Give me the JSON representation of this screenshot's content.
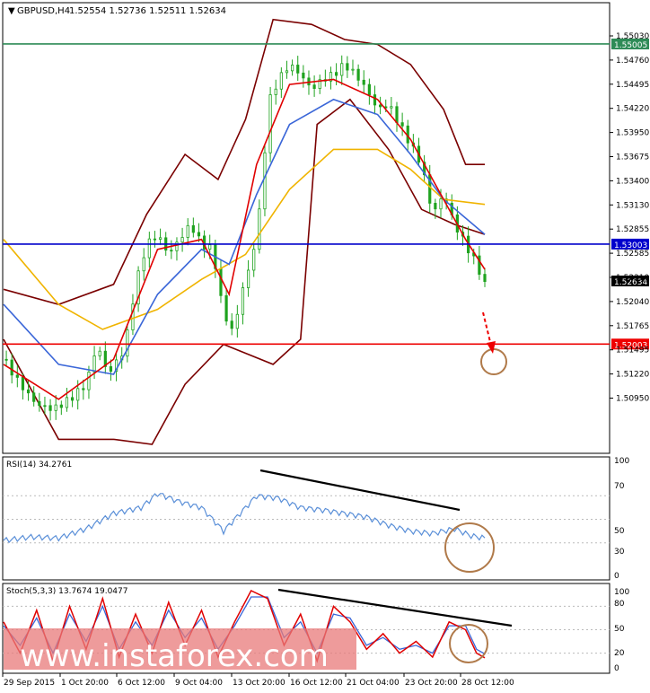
{
  "header": {
    "symbol": "GBPUSD,H4",
    "ohlc": "1.52554 1.52736 1.52511 1.52634"
  },
  "watermark": {
    "text": "www.instaforex.com"
  },
  "rsi_label": "RSI(14) 34.2761",
  "stoch_label": "Stoch(5,3,3) 13.7674 19.0477",
  "price_axis_ticks": [
    "1.55030",
    "1.54760",
    "1.54495",
    "1.54220",
    "1.53950",
    "1.53675",
    "1.53400",
    "1.53130",
    "1.52855",
    "1.52585",
    "1.52310",
    "1.52040",
    "1.51765",
    "1.51495",
    "1.51220",
    "1.50950"
  ],
  "rsi_axis_ticks": [
    "100",
    "70",
    "50",
    "30",
    "0"
  ],
  "stoch_axis_ticks": [
    "100",
    "80",
    "50",
    "20",
    "0"
  ],
  "time_labels": [
    "29 Sep 2015",
    "1 Oct 20:00",
    "6 Oct 12:00",
    "9 Oct 04:00",
    "13 Oct 20:00",
    "16 Oct 12:00",
    "21 Oct 04:00",
    "23 Oct 20:00",
    "28 Oct 12:00"
  ],
  "levels": [
    {
      "name": "resistance",
      "label": "1.55005",
      "value": 1.55005,
      "color": "#2e8b57"
    },
    {
      "name": "pivot",
      "label": "1.53003",
      "value": 1.53003,
      "color": "#0000cc"
    },
    {
      "name": "support",
      "label": "1.52003",
      "value": 1.52003,
      "color": "#ee0000"
    },
    {
      "name": "current",
      "label": "1.52634",
      "value": 1.52634,
      "color": "#000000"
    }
  ],
  "colors": {
    "up_candle": "#1fa31f",
    "down_candle": "#1fa31f",
    "fast_ma": "#e00000",
    "mid_ma": "#3a66d8",
    "slow_ma": "#f0b400",
    "envelope": "#7a0000",
    "rsi": "#5a8fd8",
    "stoch_main": "#e00000",
    "stoch_signal": "#3a66d8",
    "circle": "#b07a4a"
  },
  "chart_data": {
    "type": "candlestick",
    "instrument": "GBPUSD",
    "timeframe": "H4",
    "price_ylim": [
      1.5082,
      1.5531
    ],
    "last_close": 1.52634,
    "horizontal_levels": [
      1.55005,
      1.53003,
      1.52003
    ],
    "close_path": [
      [
        0,
        1.5185
      ],
      [
        6,
        1.516
      ],
      [
        12,
        1.514
      ],
      [
        18,
        1.5135
      ],
      [
        24,
        1.5145
      ],
      [
        30,
        1.516
      ],
      [
        34,
        1.52
      ],
      [
        38,
        1.517
      ],
      [
        44,
        1.5195
      ],
      [
        48,
        1.526
      ],
      [
        52,
        1.53
      ],
      [
        56,
        1.531
      ],
      [
        60,
        1.529
      ],
      [
        64,
        1.5305
      ],
      [
        68,
        1.532
      ],
      [
        72,
        1.53
      ],
      [
        76,
        1.5295
      ],
      [
        80,
        1.523
      ],
      [
        84,
        1.521
      ],
      [
        86,
        1.525
      ],
      [
        90,
        1.528
      ],
      [
        94,
        1.535
      ],
      [
        96,
        1.544
      ],
      [
        100,
        1.5465
      ],
      [
        104,
        1.548
      ],
      [
        108,
        1.547
      ],
      [
        112,
        1.5455
      ],
      [
        116,
        1.5465
      ],
      [
        120,
        1.547
      ],
      [
        124,
        1.548
      ],
      [
        128,
        1.547
      ],
      [
        132,
        1.5455
      ],
      [
        136,
        1.5435
      ],
      [
        140,
        1.544
      ],
      [
        144,
        1.542
      ],
      [
        148,
        1.54
      ],
      [
        152,
        1.538
      ],
      [
        156,
        1.533
      ],
      [
        160,
        1.535
      ],
      [
        164,
        1.532
      ],
      [
        168,
        1.53
      ],
      [
        172,
        1.528
      ],
      [
        175,
        1.526
      ]
    ],
    "fast_ma_path": [
      [
        0,
        1.518
      ],
      [
        20,
        1.5145
      ],
      [
        40,
        1.5185
      ],
      [
        56,
        1.5295
      ],
      [
        72,
        1.5305
      ],
      [
        82,
        1.525
      ],
      [
        92,
        1.538
      ],
      [
        104,
        1.546
      ],
      [
        120,
        1.5465
      ],
      [
        136,
        1.5445
      ],
      [
        148,
        1.5405
      ],
      [
        160,
        1.5345
      ],
      [
        168,
        1.5305
      ],
      [
        175,
        1.5275
      ]
    ],
    "mid_ma_path": [
      [
        0,
        1.524
      ],
      [
        20,
        1.518
      ],
      [
        40,
        1.517
      ],
      [
        56,
        1.525
      ],
      [
        72,
        1.5295
      ],
      [
        82,
        1.528
      ],
      [
        92,
        1.535
      ],
      [
        104,
        1.542
      ],
      [
        120,
        1.5445
      ],
      [
        136,
        1.543
      ],
      [
        148,
        1.539
      ],
      [
        160,
        1.5345
      ],
      [
        175,
        1.531
      ]
    ],
    "slow_ma_path": [
      [
        0,
        1.5305
      ],
      [
        20,
        1.524
      ],
      [
        36,
        1.5215
      ],
      [
        56,
        1.5235
      ],
      [
        72,
        1.5265
      ],
      [
        88,
        1.529
      ],
      [
        104,
        1.5355
      ],
      [
        120,
        1.5395
      ],
      [
        136,
        1.5395
      ],
      [
        148,
        1.5375
      ],
      [
        160,
        1.5345
      ],
      [
        175,
        1.534
      ]
    ],
    "upper_envelope_path": [
      [
        0,
        1.5255
      ],
      [
        20,
        1.524
      ],
      [
        40,
        1.526
      ],
      [
        52,
        1.533
      ],
      [
        66,
        1.539
      ],
      [
        78,
        1.5365
      ],
      [
        88,
        1.5425
      ],
      [
        98,
        1.5525
      ],
      [
        112,
        1.552
      ],
      [
        124,
        1.5505
      ],
      [
        136,
        1.55
      ],
      [
        148,
        1.548
      ],
      [
        160,
        1.5435
      ],
      [
        168,
        1.538
      ],
      [
        175,
        1.538
      ]
    ],
    "lower_envelope_path": [
      [
        0,
        1.5205
      ],
      [
        20,
        1.5105
      ],
      [
        40,
        1.5105
      ],
      [
        54,
        1.51
      ],
      [
        66,
        1.516
      ],
      [
        80,
        1.52
      ],
      [
        98,
        1.518
      ],
      [
        108,
        1.5205
      ],
      [
        114,
        1.542
      ],
      [
        126,
        1.5445
      ],
      [
        140,
        1.5395
      ],
      [
        152,
        1.5335
      ],
      [
        164,
        1.532
      ],
      [
        175,
        1.531
      ]
    ],
    "rsi": {
      "period": 14,
      "last": 34.2761,
      "ylim": [
        0,
        100
      ],
      "levels": [
        70,
        50,
        30
      ],
      "values": [
        [
          0,
          32
        ],
        [
          10,
          35
        ],
        [
          20,
          34
        ],
        [
          30,
          42
        ],
        [
          40,
          55
        ],
        [
          50,
          60
        ],
        [
          56,
          72
        ],
        [
          64,
          65
        ],
        [
          72,
          60
        ],
        [
          80,
          40
        ],
        [
          86,
          55
        ],
        [
          92,
          70
        ],
        [
          100,
          68
        ],
        [
          108,
          60
        ],
        [
          116,
          58
        ],
        [
          124,
          55
        ],
        [
          132,
          52
        ],
        [
          140,
          45
        ],
        [
          148,
          40
        ],
        [
          156,
          38
        ],
        [
          164,
          42
        ],
        [
          170,
          36
        ],
        [
          175,
          34
        ]
      ]
    },
    "stochastic": {
      "params": [
        5,
        3,
        3
      ],
      "main_last": 13.7674,
      "signal_last": 19.0477,
      "ylim": [
        0,
        100
      ],
      "levels": [
        80,
        50,
        20
      ],
      "main": [
        [
          0,
          60
        ],
        [
          6,
          20
        ],
        [
          12,
          75
        ],
        [
          18,
          10
        ],
        [
          24,
          80
        ],
        [
          30,
          25
        ],
        [
          36,
          90
        ],
        [
          42,
          15
        ],
        [
          48,
          70
        ],
        [
          54,
          20
        ],
        [
          60,
          85
        ],
        [
          66,
          30
        ],
        [
          72,
          75
        ],
        [
          78,
          15
        ],
        [
          84,
          60
        ],
        [
          90,
          100
        ],
        [
          96,
          90
        ],
        [
          102,
          30
        ],
        [
          108,
          70
        ],
        [
          114,
          10
        ],
        [
          120,
          80
        ],
        [
          126,
          60
        ],
        [
          132,
          25
        ],
        [
          138,
          45
        ],
        [
          144,
          20
        ],
        [
          150,
          35
        ],
        [
          156,
          15
        ],
        [
          162,
          60
        ],
        [
          168,
          50
        ],
        [
          172,
          20
        ],
        [
          175,
          14
        ]
      ],
      "signal": [
        [
          0,
          55
        ],
        [
          6,
          30
        ],
        [
          12,
          65
        ],
        [
          18,
          20
        ],
        [
          24,
          70
        ],
        [
          30,
          35
        ],
        [
          36,
          80
        ],
        [
          42,
          25
        ],
        [
          48,
          60
        ],
        [
          54,
          30
        ],
        [
          60,
          75
        ],
        [
          66,
          40
        ],
        [
          72,
          65
        ],
        [
          78,
          25
        ],
        [
          84,
          55
        ],
        [
          90,
          92
        ],
        [
          96,
          92
        ],
        [
          102,
          40
        ],
        [
          108,
          60
        ],
        [
          114,
          20
        ],
        [
          120,
          70
        ],
        [
          126,
          65
        ],
        [
          132,
          30
        ],
        [
          138,
          40
        ],
        [
          144,
          25
        ],
        [
          150,
          30
        ],
        [
          156,
          20
        ],
        [
          162,
          55
        ],
        [
          168,
          55
        ],
        [
          172,
          25
        ],
        [
          175,
          19
        ]
      ]
    }
  }
}
